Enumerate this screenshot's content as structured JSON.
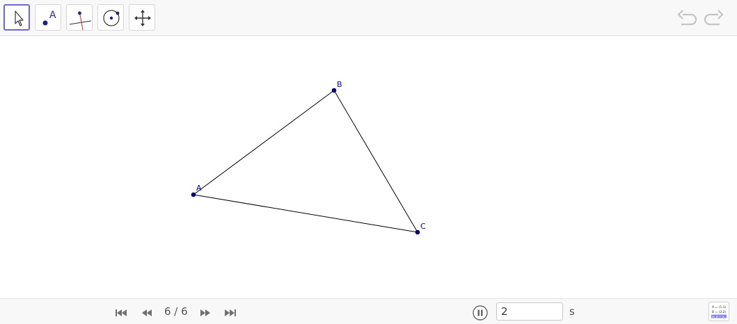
{
  "toolbar": {
    "tools": [
      {
        "name": "Move",
        "icon": "arrow-pointer-icon",
        "selected": true
      },
      {
        "name": "Point",
        "icon": "point-icon",
        "label": "A"
      },
      {
        "name": "Perpendicular Line",
        "icon": "perpendicular-line-icon"
      },
      {
        "name": "Circle with Center",
        "icon": "circle-icon"
      },
      {
        "name": "Move Graphics View",
        "icon": "move-view-icon"
      }
    ],
    "undo_icon": "undo-icon",
    "redo_icon": "redo-icon"
  },
  "points": [
    {
      "label": "A"
    },
    {
      "label": "B"
    },
    {
      "label": "C"
    }
  ],
  "colors": {
    "point": "#00007f",
    "label": "#0000cc",
    "segment": "#000000",
    "selection": "#6e64e4"
  },
  "playbar": {
    "counter": "6 / 6",
    "speed_value": "2",
    "speed_unit": "s"
  },
  "algebra_icon": {
    "lines": [
      "A = (1,1)",
      "B = (2,2)",
      "a: y = x"
    ]
  }
}
